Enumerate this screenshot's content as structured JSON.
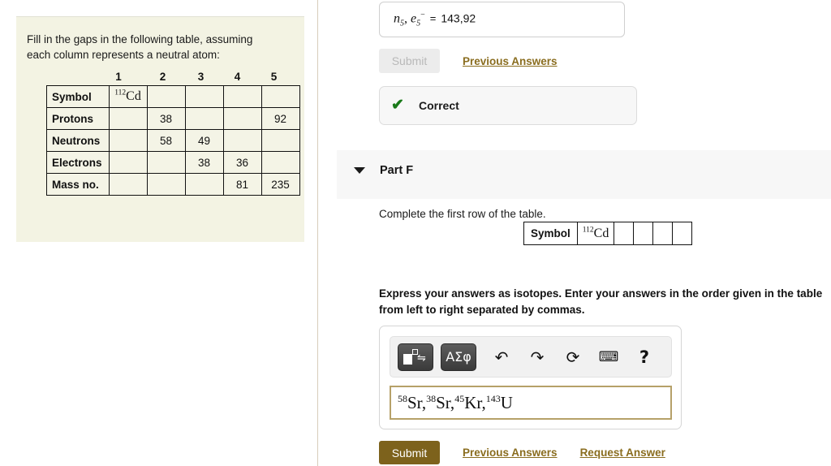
{
  "left": {
    "prompt_line1": "Fill in the gaps in the following table, assuming",
    "prompt_line2": "each column represents a neutral atom:",
    "column_headers": [
      "1",
      "2",
      "3",
      "4",
      "5"
    ],
    "rows": [
      {
        "label": "Symbol",
        "cells": [
          "112Cd",
          "",
          "",
          "",
          ""
        ]
      },
      {
        "label": "Protons",
        "cells": [
          "",
          "38",
          "",
          "",
          "92"
        ]
      },
      {
        "label": "Neutrons",
        "cells": [
          "",
          "58",
          "49",
          "",
          ""
        ]
      },
      {
        "label": "Electrons",
        "cells": [
          "",
          "",
          "38",
          "36",
          ""
        ]
      },
      {
        "label": "Mass no.",
        "cells": [
          "",
          "",
          "",
          "81",
          "235"
        ]
      }
    ],
    "symbol_cell": {
      "mass": "112",
      "element": "Cd"
    }
  },
  "right": {
    "previous_answer": {
      "var1": "n",
      "var1_sub": "5",
      "var2": "e",
      "var2_sub": "5",
      "var2_sup": "−",
      "equals": "=",
      "value": "143,92"
    },
    "submit_disabled_label": "Submit",
    "previous_answers_label": "Previous Answers",
    "feedback": {
      "check_icon": "check-icon",
      "label": "Correct",
      "color": "#1a7a1a"
    },
    "part": {
      "caret_icon": "caret-down-icon",
      "title": "Part F"
    },
    "instruction": "Complete the first row of the table.",
    "symbol_row": {
      "label": "Symbol",
      "mass": "112",
      "element": "Cd",
      "blank_cells": [
        "",
        "",
        "",
        ""
      ]
    },
    "express_line1": "Express your answers as isotopes. Enter your answers in the order given in the",
    "express_line2": "table from left to right separated by commas.",
    "toolbar": {
      "template_button": "template-toggle-icon",
      "greek_button": "ΑΣφ",
      "undo_icon": "↶",
      "redo_icon": "↷",
      "reset_icon": "⟳",
      "keyboard_icon": "⌨",
      "help_icon": "?"
    },
    "answer": {
      "parts": [
        {
          "sup": "58",
          "text": "Sr,"
        },
        {
          "sup": "38",
          "text": "Sr,"
        },
        {
          "sup": "45",
          "text": "Kr,"
        },
        {
          "sup": "143",
          "text": "U"
        }
      ],
      "border_color": "#b6a169"
    },
    "submit_label": "Submit",
    "previous_answers_label_2": "Previous Answers",
    "request_answer_label": "Request Answer",
    "submit_color": "#7d621c",
    "link_color": "#8a6d1f"
  }
}
